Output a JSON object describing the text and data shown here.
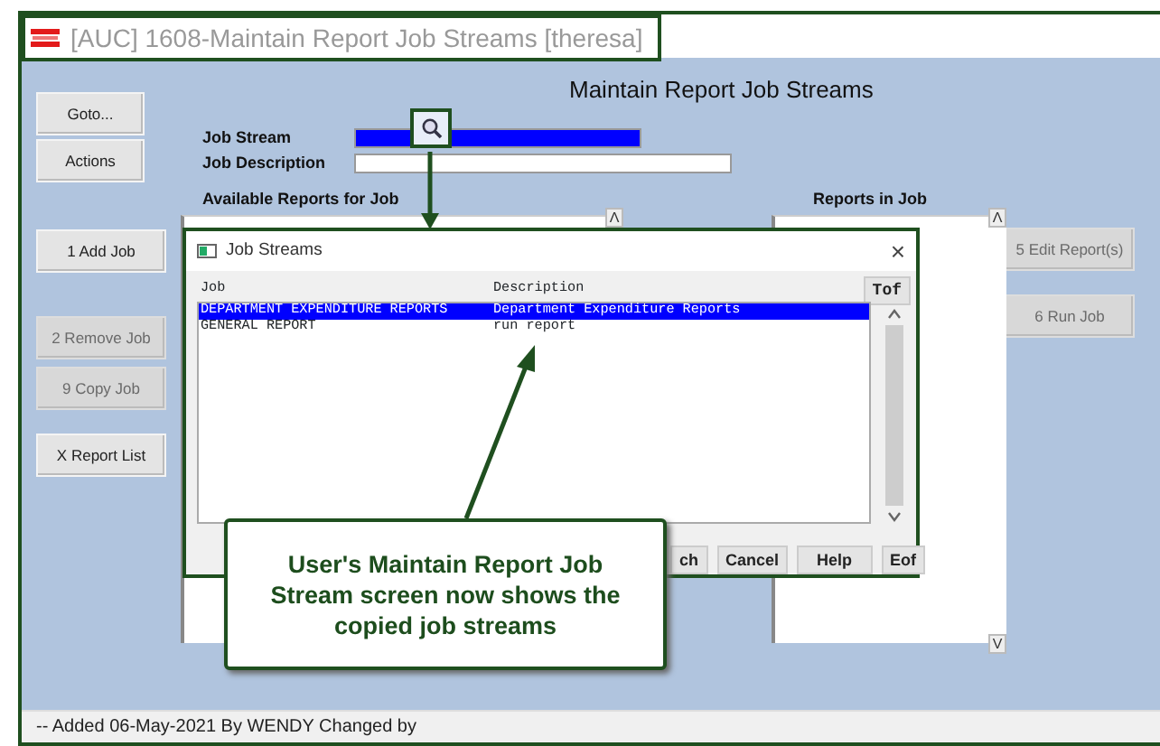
{
  "window": {
    "title": "[AUC] 1608-Maintain Report Job Streams [theresa]"
  },
  "heading": "Maintain Report Job Streams",
  "top_buttons": [
    {
      "label": "Goto...",
      "disabled": false
    },
    {
      "label": "Actions",
      "disabled": false
    }
  ],
  "left_buttons": [
    {
      "label": "1 Add Job",
      "disabled": false
    },
    {
      "label": "2 Remove Job",
      "disabled": true
    },
    {
      "label": "9 Copy Job",
      "disabled": true
    },
    {
      "label": "X Report List",
      "disabled": false
    }
  ],
  "fields": [
    {
      "label": "Job Stream",
      "focused": true
    },
    {
      "label": "Job Description",
      "focused": false
    }
  ],
  "lists": [
    {
      "label": "Available Reports for Job",
      "scroll_up": "Λ"
    },
    {
      "label": "Reports in Job",
      "scroll_up": "Λ",
      "scroll_down": "V"
    }
  ],
  "right_buttons": [
    {
      "label": "5 Edit Report(s)",
      "disabled": true
    },
    {
      "label": "6 Run Job",
      "disabled": true
    }
  ],
  "dialog": {
    "title": "Job Streams",
    "close": "×",
    "columns": [
      "Job",
      "Description"
    ],
    "top_button": "Tof",
    "rows": [
      {
        "job": "DEPARTMENT EXPENDITURE REPORTS",
        "description": "Department Expenditure Reports",
        "selected": true
      },
      {
        "job": "GENERAL REPORT",
        "description": "run report",
        "selected": false
      }
    ],
    "buttons": [
      "ch",
      "Cancel",
      "Help"
    ],
    "bottom_button": "Eof"
  },
  "callout": "User's Maintain Report Job Stream screen now shows the copied job streams",
  "status_bar": "-- Added 06-May-2021 By WENDY Changed  by"
}
